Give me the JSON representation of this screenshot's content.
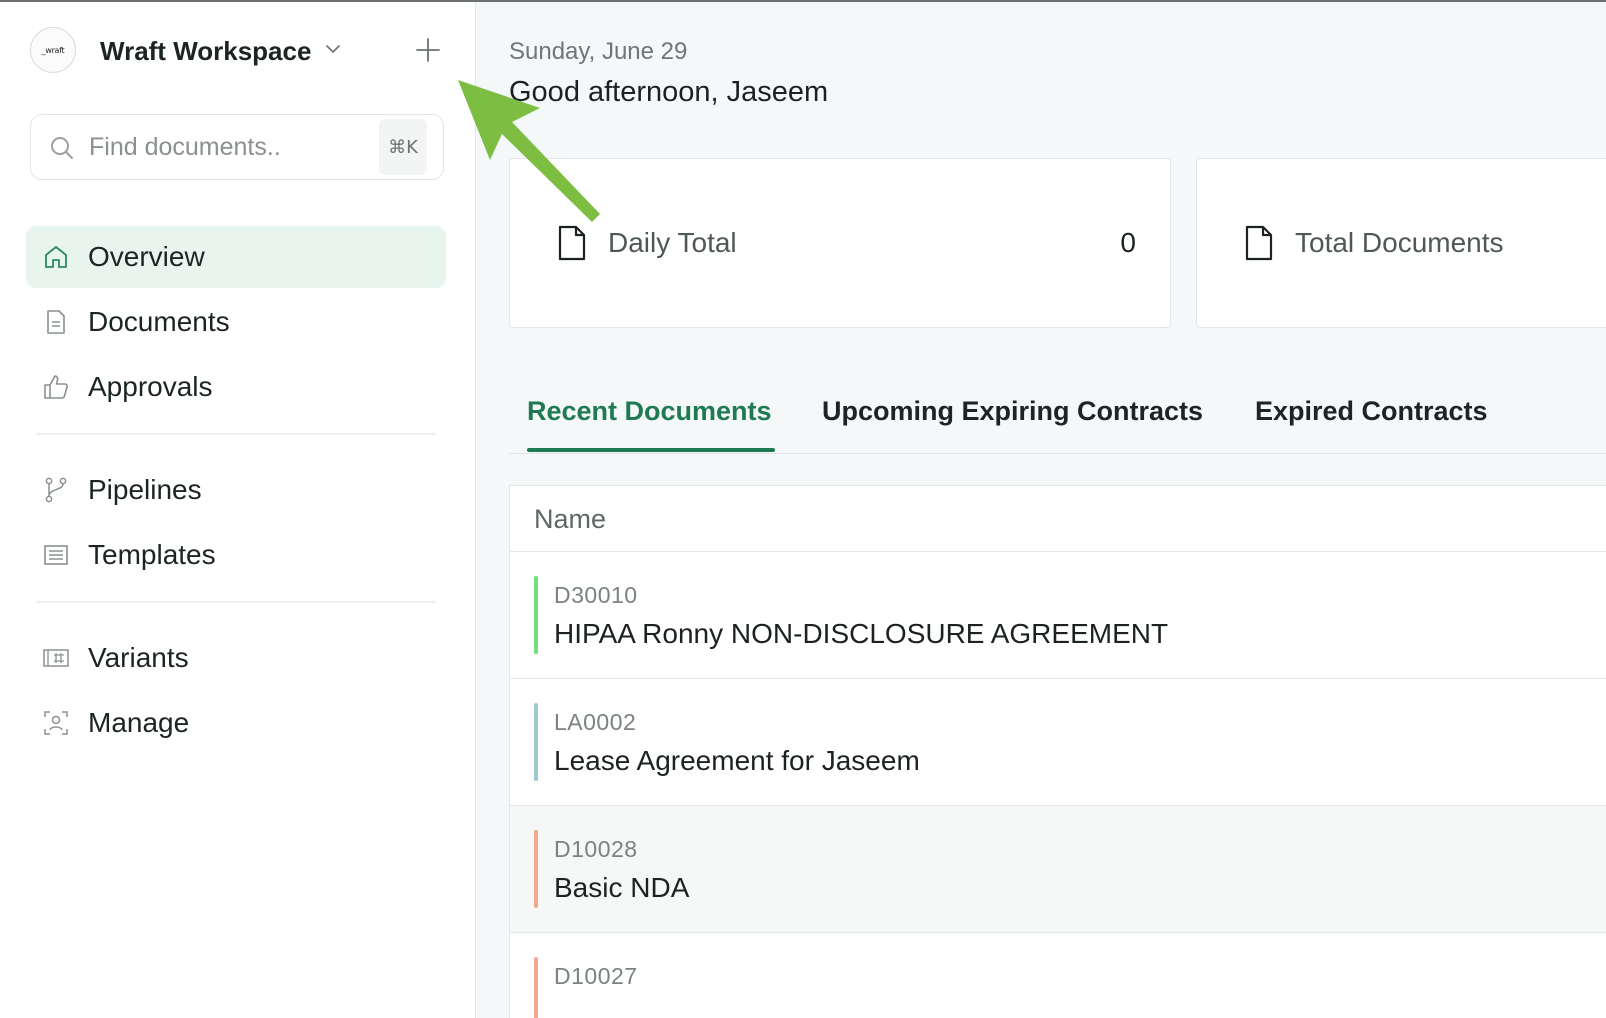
{
  "workspace": {
    "logo_text": "_wraft",
    "name": "Wraft Workspace"
  },
  "search": {
    "placeholder": "Find documents..",
    "value": "",
    "shortcut": "⌘K"
  },
  "sidebar": {
    "items": [
      {
        "label": "Overview",
        "icon": "home-icon",
        "active": true
      },
      {
        "label": "Documents",
        "icon": "document-icon",
        "active": false
      },
      {
        "label": "Approvals",
        "icon": "thumbs-up-icon",
        "active": false
      },
      {
        "label": "Pipelines",
        "icon": "branch-icon",
        "active": false
      },
      {
        "label": "Templates",
        "icon": "template-icon",
        "active": false
      },
      {
        "label": "Variants",
        "icon": "variant-icon",
        "active": false
      },
      {
        "label": "Manage",
        "icon": "user-frame-icon",
        "active": false
      }
    ]
  },
  "header": {
    "date": "Sunday, June 29",
    "greeting": "Good afternoon, Jaseem"
  },
  "stats": [
    {
      "label": "Daily Total",
      "value": "0",
      "icon": "file-icon"
    },
    {
      "label": "Total Documents",
      "value": "",
      "icon": "file-icon"
    }
  ],
  "tabs": [
    {
      "label": "Recent Documents",
      "active": true
    },
    {
      "label": "Upcoming Expiring Contracts",
      "active": false
    },
    {
      "label": "Expired Contracts",
      "active": false
    }
  ],
  "table": {
    "header_name": "Name",
    "rows": [
      {
        "id": "D30010",
        "title": "HIPAA Ronny NON-DISCLOSURE AGREEMENT",
        "accent": "#6fe07c"
      },
      {
        "id": "LA0002",
        "title": "Lease Agreement for Jaseem",
        "accent": "#9ccbd0"
      },
      {
        "id": "D10028",
        "title": "Basic NDA",
        "accent": "#f2a88c"
      },
      {
        "id": "D10027",
        "title": "",
        "accent": "#f2a88c"
      }
    ]
  },
  "colors": {
    "brand": "#1f7a54",
    "active_nav_bg": "#e8f5ee",
    "annotation_arrow": "#7cbd42"
  }
}
